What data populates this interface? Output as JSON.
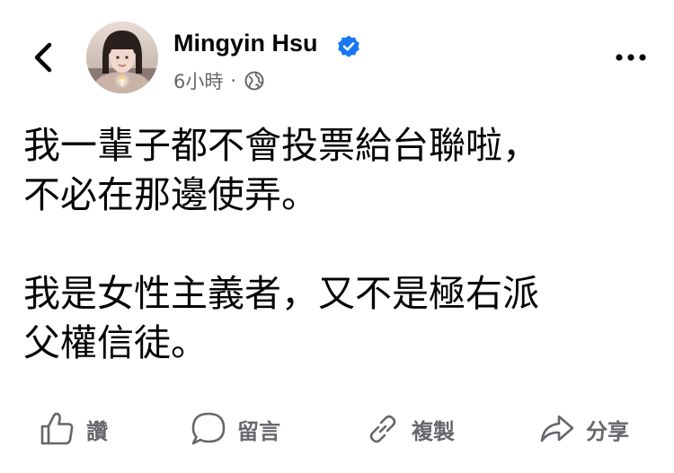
{
  "header": {
    "author_name": "Mingyin Hsu",
    "timestamp": "6小時",
    "separator": "·",
    "verified": true,
    "audience_icon": "globe-icon",
    "back_icon": "chevron-left-icon",
    "more_icon": "more-dots-icon"
  },
  "post": {
    "paragraph1": [
      "我一輩子都不會投票給台聯啦，",
      "不必在那邊使弄。"
    ],
    "paragraph2": [
      "我是女性主義者，又不是極右派",
      "父權信徒。"
    ]
  },
  "actions": [
    {
      "label": "讚",
      "icon": "like-icon"
    },
    {
      "label": "留言",
      "icon": "comment-icon"
    },
    {
      "label": "複製",
      "icon": "link-icon"
    },
    {
      "label": "分享",
      "icon": "share-icon"
    }
  ],
  "colors": {
    "text": "#050505",
    "secondary": "#65676b",
    "verified_blue": "#1877f2"
  }
}
